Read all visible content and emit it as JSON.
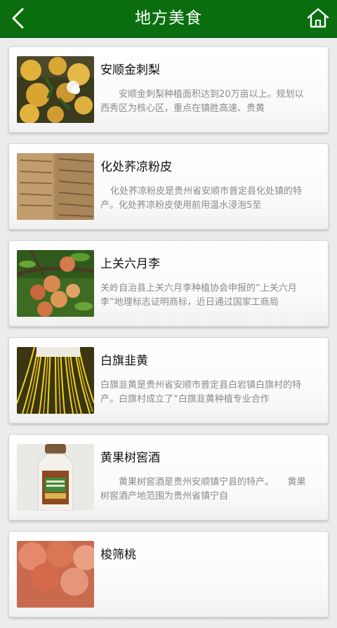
{
  "header": {
    "title": "地方美食",
    "back_icon": "chevron-left-icon",
    "home_icon": "home-icon",
    "bar_color": "#0a6e0e"
  },
  "items": [
    {
      "title": "安顺金刺梨",
      "description": "安顺金刺梨种植面积达到20万亩以上。规划以西秀区为核心区，重点在镇胜高速、贵黄",
      "image": "golden-pear-photo"
    },
    {
      "title": "化处荞凉粉皮",
      "description": "化处荞凉粉皮是贵州省安顺市普定县化处镇的特产。化处荞凉粉皮使用前用温水浸泡5至",
      "image": "buckwheat-jelly-sheet-photo"
    },
    {
      "title": "上关六月李",
      "description": "关岭自治县上关六月李种植协会申报的“上关六月李”地理标志证明商标，近日通过国家工商局",
      "image": "plum-tree-photo"
    },
    {
      "title": "白旗韭黄",
      "description": "白旗韭黄是贵州省安顺市普定县白岩镇白旗村的特产。白旗村成立了“白旗韭黄种植专业合作",
      "image": "yellow-chives-photo"
    },
    {
      "title": "黄果树窖酒",
      "description": "黄果树窖酒是贵州安顺镇宁县的特产。　　黄果树窖酒产地范围为贵州省镇宁自",
      "image": "liquor-bottle-photo"
    },
    {
      "title": "梭筛桃",
      "description": "",
      "image": "peach-photo"
    }
  ]
}
